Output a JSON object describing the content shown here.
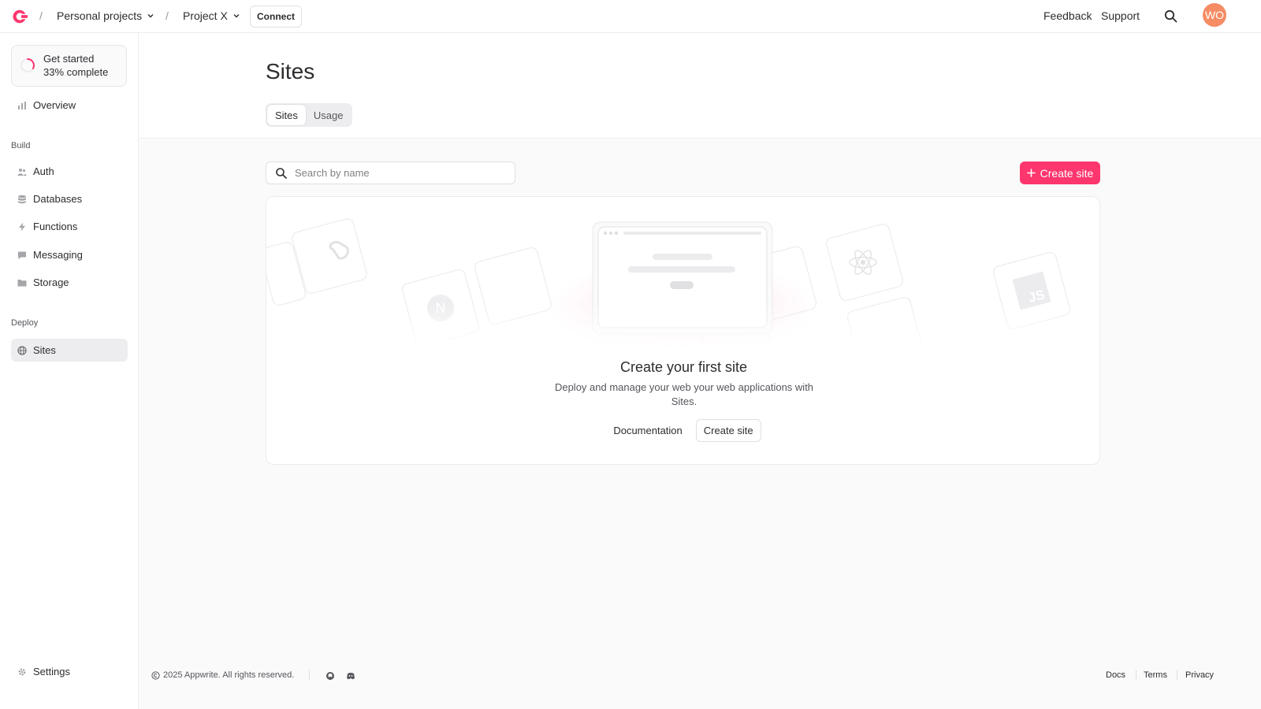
{
  "topbar": {
    "logo_icon": "appwrite-logo-icon",
    "org": "Personal projects",
    "project": "Project X",
    "connect": "Connect",
    "feedback": "Feedback",
    "support": "Support",
    "avatar_initials": "WO",
    "accent": "#fd366e"
  },
  "sidebar": {
    "get_started": {
      "title": "Get started",
      "progress_text": "33% complete",
      "progress": 0.33
    },
    "overview": "Overview",
    "build_section": "Build",
    "build_items": [
      {
        "label": "Auth",
        "icon": "users-icon"
      },
      {
        "label": "Databases",
        "icon": "database-icon"
      },
      {
        "label": "Functions",
        "icon": "lightning-icon"
      },
      {
        "label": "Messaging",
        "icon": "chat-icon"
      },
      {
        "label": "Storage",
        "icon": "folder-icon"
      }
    ],
    "deploy_section": "Deploy",
    "deploy_items": [
      {
        "label": "Sites",
        "icon": "globe-icon",
        "active": true
      }
    ],
    "settings": "Settings"
  },
  "main": {
    "title": "Sites",
    "tabs": [
      {
        "label": "Sites",
        "active": true
      },
      {
        "label": "Usage",
        "active": false
      }
    ],
    "search_placeholder": "Search by name",
    "create_button": "Create site",
    "empty": {
      "title": "Create your first site",
      "description": "Deploy and manage your web your web applications with Sites.",
      "docs_button": "Documentation",
      "create_button": "Create site"
    }
  },
  "footer": {
    "copyright": "2025 Appwrite. All rights reserved.",
    "links": [
      "Docs",
      "Terms",
      "Privacy"
    ]
  }
}
